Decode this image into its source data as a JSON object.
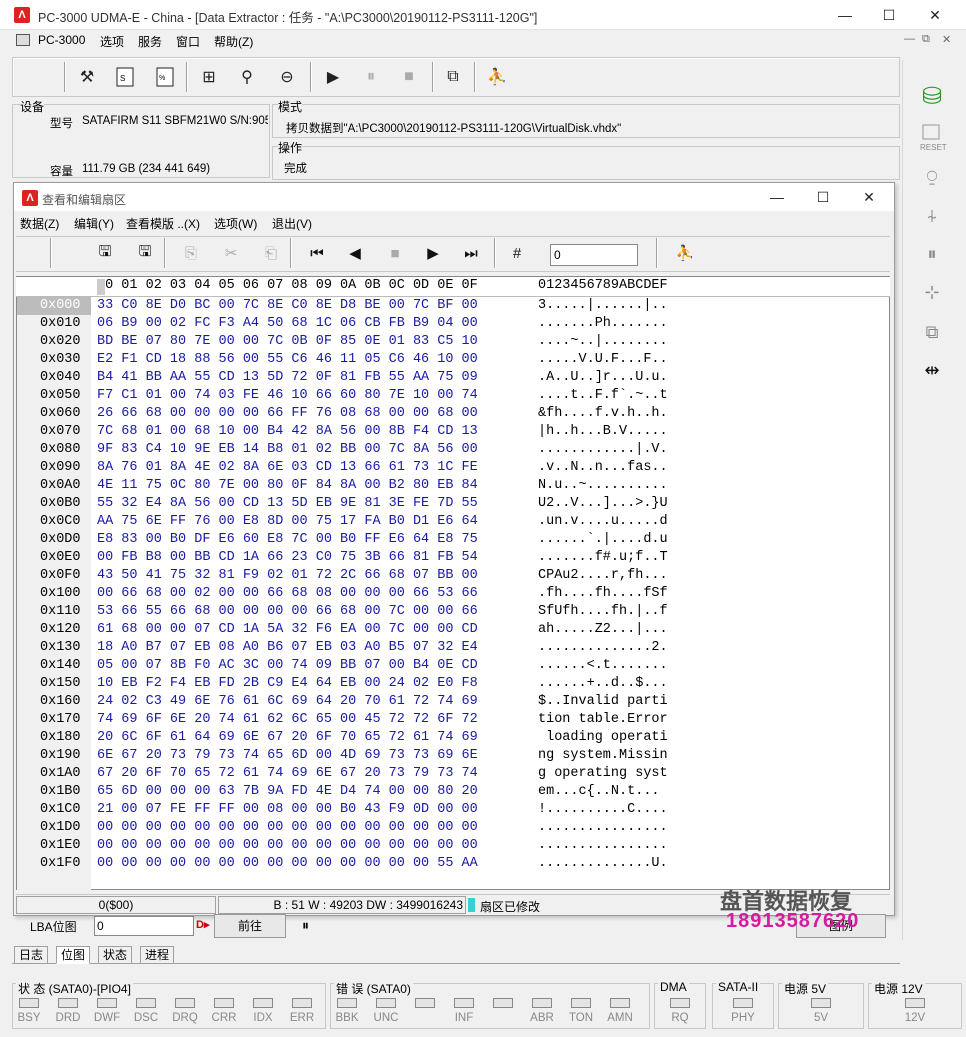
{
  "window": {
    "title": "PC-3000 UDMA-E - China - [Data Extractor : 任务 - \"A:\\PC3000\\20190112-PS3111-120G\"]",
    "min": "—",
    "max": "☐",
    "close": "✕"
  },
  "menubar": {
    "app": "PC-3000",
    "items": [
      "选项",
      "服务",
      "窗口",
      "帮助(Z)"
    ],
    "min": "—",
    "restore": "⧉",
    "close": "✕"
  },
  "device": {
    "group_label": "设备",
    "model_label": "型号",
    "model_value": "SATAFIRM   S11 SBFM21W0 S/N:905",
    "capacity_label": "容量",
    "capacity_value": "111.79 GB (234 441 649)"
  },
  "mode": {
    "group_label": "模式",
    "value": "拷贝数据到\"A:\\PC3000\\20190112-PS3111-120G\\VirtualDisk.vhdx\""
  },
  "operation": {
    "group_label": "操作",
    "value": "完成"
  },
  "child_window": {
    "title": "查看和编辑扇区",
    "menu": [
      "数据(Z)",
      "编辑(Y)",
      "查看模版 ..(X)",
      "选项(W)",
      "退出(V)"
    ],
    "goto_value": "0",
    "min": "—",
    "max": "☐",
    "close": "✕"
  },
  "hex": {
    "header_bytes": "00 01 02 03 04 05 06 07 08 09 0A 0B 0C 0D 0E 0F",
    "header_ascii": "0123456789ABCDEF",
    "rows": [
      {
        "off": "0x000",
        "bytes": "33 C0 8E D0 BC 00 7C 8E C0 8E D8 BE 00 7C BF 00",
        "ascii": "3.....|......|.."
      },
      {
        "off": "0x010",
        "bytes": "06 B9 00 02 FC F3 A4 50 68 1C 06 CB FB B9 04 00",
        "ascii": ".......Ph......."
      },
      {
        "off": "0x020",
        "bytes": "BD BE 07 80 7E 00 00 7C 0B 0F 85 0E 01 83 C5 10",
        "ascii": "....~..|........"
      },
      {
        "off": "0x030",
        "bytes": "E2 F1 CD 18 88 56 00 55 C6 46 11 05 C6 46 10 00",
        "ascii": ".....V.U.F...F.."
      },
      {
        "off": "0x040",
        "bytes": "B4 41 BB AA 55 CD 13 5D 72 0F 81 FB 55 AA 75 09",
        "ascii": ".A..U..]r...U.u."
      },
      {
        "off": "0x050",
        "bytes": "F7 C1 01 00 74 03 FE 46 10 66 60 80 7E 10 00 74",
        "ascii": "....t..F.f`.~..t"
      },
      {
        "off": "0x060",
        "bytes": "26 66 68 00 00 00 00 66 FF 76 08 68 00 00 68 00",
        "ascii": "&fh....f.v.h..h."
      },
      {
        "off": "0x070",
        "bytes": "7C 68 01 00 68 10 00 B4 42 8A 56 00 8B F4 CD 13",
        "ascii": "|h..h...B.V....."
      },
      {
        "off": "0x080",
        "bytes": "9F 83 C4 10 9E EB 14 B8 01 02 BB 00 7C 8A 56 00",
        "ascii": "............|.V."
      },
      {
        "off": "0x090",
        "bytes": "8A 76 01 8A 4E 02 8A 6E 03 CD 13 66 61 73 1C FE",
        "ascii": ".v..N..n...fas.."
      },
      {
        "off": "0x0A0",
        "bytes": "4E 11 75 0C 80 7E 00 80 0F 84 8A 00 B2 80 EB 84",
        "ascii": "N.u..~.........."
      },
      {
        "off": "0x0B0",
        "bytes": "55 32 E4 8A 56 00 CD 13 5D EB 9E 81 3E FE 7D 55",
        "ascii": "U2..V...]...>.}U"
      },
      {
        "off": "0x0C0",
        "bytes": "AA 75 6E FF 76 00 E8 8D 00 75 17 FA B0 D1 E6 64",
        "ascii": ".un.v....u.....d"
      },
      {
        "off": "0x0D0",
        "bytes": "E8 83 00 B0 DF E6 60 E8 7C 00 B0 FF E6 64 E8 75",
        "ascii": "......`.|....d.u"
      },
      {
        "off": "0x0E0",
        "bytes": "00 FB B8 00 BB CD 1A 66 23 C0 75 3B 66 81 FB 54",
        "ascii": ".......f#.u;f..T"
      },
      {
        "off": "0x0F0",
        "bytes": "43 50 41 75 32 81 F9 02 01 72 2C 66 68 07 BB 00",
        "ascii": "CPAu2....r,fh..."
      },
      {
        "off": "0x100",
        "bytes": "00 66 68 00 02 00 00 66 68 08 00 00 00 66 53 66",
        "ascii": ".fh....fh....fSf"
      },
      {
        "off": "0x110",
        "bytes": "53 66 55 66 68 00 00 00 00 66 68 00 7C 00 00 66",
        "ascii": "SfUfh....fh.|..f"
      },
      {
        "off": "0x120",
        "bytes": "61 68 00 00 07 CD 1A 5A 32 F6 EA 00 7C 00 00 CD",
        "ascii": "ah.....Z2...|..."
      },
      {
        "off": "0x130",
        "bytes": "18 A0 B7 07 EB 08 A0 B6 07 EB 03 A0 B5 07 32 E4",
        "ascii": "..............2."
      },
      {
        "off": "0x140",
        "bytes": "05 00 07 8B F0 AC 3C 00 74 09 BB 07 00 B4 0E CD",
        "ascii": "......<.t......."
      },
      {
        "off": "0x150",
        "bytes": "10 EB F2 F4 EB FD 2B C9 E4 64 EB 00 24 02 E0 F8",
        "ascii": "......+..d..$..."
      },
      {
        "off": "0x160",
        "bytes": "24 02 C3 49 6E 76 61 6C 69 64 20 70 61 72 74 69",
        "ascii": "$..Invalid parti"
      },
      {
        "off": "0x170",
        "bytes": "74 69 6F 6E 20 74 61 62 6C 65 00 45 72 72 6F 72",
        "ascii": "tion table.Error"
      },
      {
        "off": "0x180",
        "bytes": "20 6C 6F 61 64 69 6E 67 20 6F 70 65 72 61 74 69",
        "ascii": " loading operati"
      },
      {
        "off": "0x190",
        "bytes": "6E 67 20 73 79 73 74 65 6D 00 4D 69 73 73 69 6E",
        "ascii": "ng system.Missin"
      },
      {
        "off": "0x1A0",
        "bytes": "67 20 6F 70 65 72 61 74 69 6E 67 20 73 79 73 74",
        "ascii": "g operating syst"
      },
      {
        "off": "0x1B0",
        "bytes": "65 6D 00 00 00 63 7B 9A FD 4E D4 74 00 00 80 20",
        "ascii": "em...c{..N.t... "
      },
      {
        "off": "0x1C0",
        "bytes": "21 00 07 FE FF FF 00 08 00 00 B0 43 F9 0D 00 00",
        "ascii": "!..........C...."
      },
      {
        "off": "0x1D0",
        "bytes": "00 00 00 00 00 00 00 00 00 00 00 00 00 00 00 00",
        "ascii": "................"
      },
      {
        "off": "0x1E0",
        "bytes": "00 00 00 00 00 00 00 00 00 00 00 00 00 00 00 00",
        "ascii": "................"
      },
      {
        "off": "0x1F0",
        "bytes": "00 00 00 00 00 00 00 00 00 00 00 00 00 00 55 AA",
        "ascii": "..............U."
      }
    ]
  },
  "child_status": {
    "position": "0($00)",
    "value": "B : 51 W : 49203 DW : 3499016243",
    "modified": "扇区已修改"
  },
  "lba": {
    "label": "LBA位图",
    "value": "0",
    "goto_button": "前往",
    "pause": "⏸",
    "map_button": "图例"
  },
  "tabs": [
    "日志",
    "位图",
    "状态",
    "进程"
  ],
  "status_groups": [
    {
      "label": "状 态 (SATA0)-[PIO4]",
      "leds": [
        "BSY",
        "DRD",
        "DWF",
        "DSC",
        "DRQ",
        "CRR",
        "IDX",
        "ERR"
      ]
    },
    {
      "label": "错 误 (SATA0)",
      "leds": [
        "BBK",
        "UNC",
        "",
        "INF",
        "",
        "ABR",
        "TON",
        "AMN"
      ]
    },
    {
      "label": "DMA",
      "leds": [
        "RQ"
      ]
    },
    {
      "label": "SATA-II",
      "leds": [
        "PHY"
      ]
    },
    {
      "label": "电源 5V",
      "leds": [
        "5V"
      ]
    },
    {
      "label": "电源 12V",
      "leds": [
        "12V"
      ]
    }
  ],
  "watermark": {
    "line1": "盘首数据恢复",
    "line2": "18913587620"
  },
  "colors": {
    "hex_bytes": "#1a1aa8",
    "brand_red": "#d22222",
    "watermark_pink": "#d61aa0"
  }
}
